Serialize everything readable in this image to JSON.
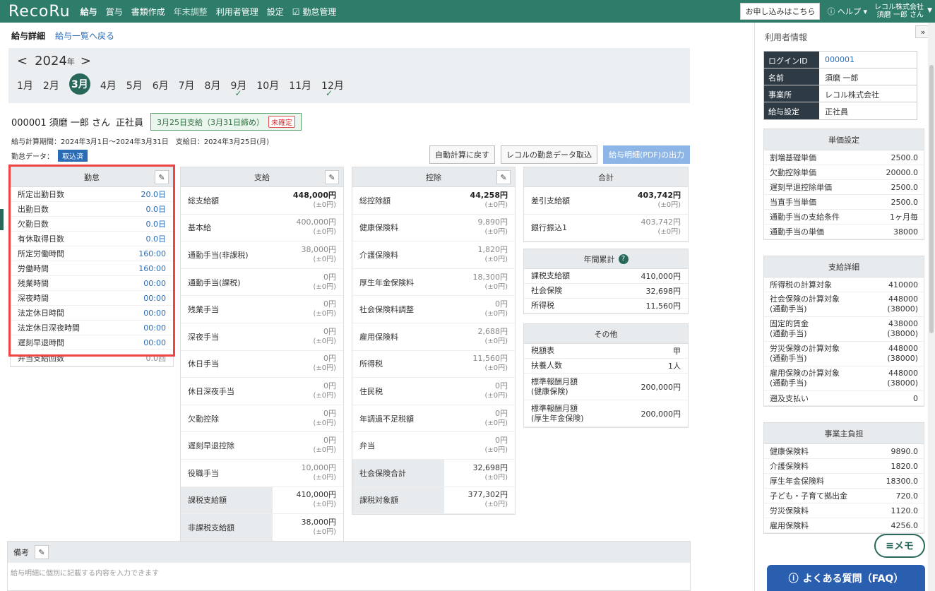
{
  "nav": {
    "logo": "RecoRu",
    "items": [
      {
        "label": "給与",
        "active": true
      },
      {
        "label": "賞与",
        "active": false
      },
      {
        "label": "書類作成",
        "active": false
      },
      {
        "label": "年末調整",
        "dim": true
      },
      {
        "label": "利用者管理",
        "active": false
      },
      {
        "label": "設定",
        "active": false
      },
      {
        "label": "勤怠管理",
        "active": false
      }
    ],
    "apply": "お申し込みはこちら",
    "help": "ヘルプ",
    "company": "レコル株式会社",
    "user": "須磨 一郎 さん"
  },
  "header": {
    "title": "給与詳細",
    "back": "給与一覧へ戻る"
  },
  "calendar": {
    "year": "2024",
    "year_suffix": "年",
    "months": [
      "1月",
      "2月",
      "3月",
      "4月",
      "5月",
      "6月",
      "7月",
      "8月",
      "9月",
      "10月",
      "11月",
      "12月"
    ],
    "selected": "3月",
    "checked": [
      "9月",
      "12月"
    ]
  },
  "employee": {
    "id_name": "000001 須磨 一郎 さん",
    "type": "正社員",
    "pay_badge": "3月25日支給（3月31日締め）",
    "status": "未確定",
    "period": "給与計算期間：2024年3月1日〜2024年3月31日　支給日：2024年3月25日(月)",
    "attendance_label": "勤怠データ：",
    "attendance_status": "取込済"
  },
  "buttons": {
    "auto": "自動計算に戻す",
    "import": "レコルの勤怠データ取込",
    "pdf": "給与明細(PDF)の出力"
  },
  "attendance": {
    "title": "勤怠",
    "rows": [
      {
        "k": "所定出勤日数",
        "v": "20.0日"
      },
      {
        "k": "出勤日数",
        "v": "0.0日"
      },
      {
        "k": "欠勤日数",
        "v": "0.0日"
      },
      {
        "k": "有休取得日数",
        "v": "0.0日"
      },
      {
        "k": "所定労働時間",
        "v": "160:00"
      },
      {
        "k": "労働時間",
        "v": "160:00"
      },
      {
        "k": "残業時間",
        "v": "00:00"
      },
      {
        "k": "深夜時間",
        "v": "00:00"
      },
      {
        "k": "法定休日時間",
        "v": "00:00"
      },
      {
        "k": "法定休日深夜時間",
        "v": "00:00"
      },
      {
        "k": "遅刻早退時間",
        "v": "00:00"
      }
    ],
    "extra": {
      "k": "弁当支給回数",
      "v": "0.0回"
    }
  },
  "payment": {
    "title": "支給",
    "rows": [
      {
        "k": "総支給額",
        "v": "448,000円",
        "d": "(±0円)",
        "bold": true
      },
      {
        "k": "基本給",
        "v": "400,000円",
        "d": "(±0円)"
      },
      {
        "k": "通勤手当(非課税)",
        "v": "38,000円",
        "d": "(±0円)"
      },
      {
        "k": "通勤手当(課税)",
        "v": "0円",
        "d": "(±0円)"
      },
      {
        "k": "残業手当",
        "v": "0円",
        "d": "(±0円)"
      },
      {
        "k": "深夜手当",
        "v": "0円",
        "d": "(±0円)"
      },
      {
        "k": "休日手当",
        "v": "0円",
        "d": "(±0円)"
      },
      {
        "k": "休日深夜手当",
        "v": "0円",
        "d": "(±0円)"
      },
      {
        "k": "欠勤控除",
        "v": "0円",
        "d": "(±0円)"
      },
      {
        "k": "遅刻早退控除",
        "v": "0円",
        "d": "(±0円)"
      },
      {
        "k": "役職手当",
        "v": "10,000円",
        "d": "(±0円)"
      },
      {
        "k": "課税支給額",
        "v": "410,000円",
        "d": "(±0円)",
        "shade": true
      },
      {
        "k": "非課税支給額",
        "v": "38,000円",
        "d": "(±0円)",
        "shade": true
      }
    ]
  },
  "deduction": {
    "title": "控除",
    "rows": [
      {
        "k": "総控除額",
        "v": "44,258円",
        "d": "(±0円)",
        "bold": true
      },
      {
        "k": "健康保険料",
        "v": "9,890円",
        "d": "(±0円)"
      },
      {
        "k": "介護保険料",
        "v": "1,820円",
        "d": "(±0円)"
      },
      {
        "k": "厚生年金保険料",
        "v": "18,300円",
        "d": "(±0円)"
      },
      {
        "k": "社会保険料調整",
        "v": "0円",
        "d": "(±0円)"
      },
      {
        "k": "雇用保険料",
        "v": "2,688円",
        "d": "(±0円)"
      },
      {
        "k": "所得税",
        "v": "11,560円",
        "d": "(±0円)"
      },
      {
        "k": "住民税",
        "v": "0円",
        "d": "(±0円)"
      },
      {
        "k": "年調過不足税額",
        "v": "0円",
        "d": "(±0円)"
      },
      {
        "k": "弁当",
        "v": "0円",
        "d": "(±0円)"
      },
      {
        "k": "社会保険合計",
        "v": "32,698円",
        "d": "(±0円)",
        "shade": true
      },
      {
        "k": "課税対象額",
        "v": "377,302円",
        "d": "(±0円)",
        "shade": true
      }
    ]
  },
  "total": {
    "title": "合計",
    "rows": [
      {
        "k": "差引支給額",
        "v": "403,742円",
        "d": "(±0円)",
        "bold": true
      },
      {
        "k": "銀行振込1",
        "v": "403,742円",
        "d": "(±0円)"
      }
    ]
  },
  "annual": {
    "title": "年間累計",
    "rows": [
      {
        "k": "課税支給額",
        "v": "410,000円"
      },
      {
        "k": "社会保険",
        "v": "32,698円"
      },
      {
        "k": "所得税",
        "v": "11,560円"
      }
    ]
  },
  "other": {
    "title": "その他",
    "rows": [
      {
        "k": "税額表",
        "v": "甲"
      },
      {
        "k": "扶養人数",
        "v": "1人"
      },
      {
        "k": "標準報酬月額\n(健康保険)",
        "v": "200,000円"
      },
      {
        "k": "標準報酬月額\n(厚生年金保険)",
        "v": "200,000円"
      }
    ]
  },
  "remark": {
    "title": "備考",
    "placeholder": "給与明細に個別に記載する内容を入力できます"
  },
  "user_info": {
    "title": "利用者情報",
    "rows": [
      {
        "k": "ログインID",
        "v": "000001",
        "link": true
      },
      {
        "k": "名前",
        "v": "須磨 一郎"
      },
      {
        "k": "事業所",
        "v": "レコル株式会社"
      },
      {
        "k": "給与設定",
        "v": "正社員"
      }
    ]
  },
  "unit_settings": {
    "title": "単価設定",
    "rows": [
      {
        "k": "割増基礎単価",
        "v": "2500.0"
      },
      {
        "k": "欠勤控除単価",
        "v": "20000.0"
      },
      {
        "k": "遅刻早退控除単価",
        "v": "2500.0"
      },
      {
        "k": "当直手当単価",
        "v": "2500.0"
      },
      {
        "k": "通勤手当の支給条件",
        "v": "1ヶ月毎"
      },
      {
        "k": "通勤手当の単価",
        "v": "38000"
      }
    ]
  },
  "pay_detail": {
    "title": "支給詳細",
    "rows": [
      {
        "k": "所得税の計算対象",
        "v": "410000"
      },
      {
        "k": "社会保険の計算対象\n(通勤手当)",
        "v": "448000\n(38000)"
      },
      {
        "k": "固定的賃金\n(通勤手当)",
        "v": "438000\n(38000)"
      },
      {
        "k": "労災保険の計算対象\n(通勤手当)",
        "v": "448000\n(38000)"
      },
      {
        "k": "雇用保険の計算対象\n(通勤手当)",
        "v": "448000\n(38000)"
      },
      {
        "k": "遡及支払い",
        "v": "0"
      }
    ]
  },
  "employer": {
    "title": "事業主負担",
    "rows": [
      {
        "k": "健康保険料",
        "v": "9890.0"
      },
      {
        "k": "介護保険料",
        "v": "1820.0"
      },
      {
        "k": "厚生年金保険料",
        "v": "18300.0"
      },
      {
        "k": "子ども・子育て拠出金",
        "v": "720.0"
      },
      {
        "k": "労災保険料",
        "v": "1120.0"
      },
      {
        "k": "雇用保険料",
        "v": "4256.0"
      }
    ]
  },
  "memo": "メモ",
  "faq": "よくある質問（FAQ）"
}
